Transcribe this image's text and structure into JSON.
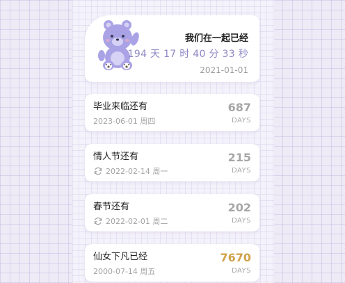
{
  "hero": {
    "title": "我们在一起已经",
    "counter": "194 天 17 时 40 分 33 秒",
    "start_date": "2021-01-01",
    "icon": "bear-mascot-icon"
  },
  "events": [
    {
      "title": "毕业来临还有",
      "date": "2023-06-01 周四",
      "days": "687",
      "unit": "DAYS",
      "repeat": false,
      "color": "#a6a6a6"
    },
    {
      "title": "情人节还有",
      "date": "2022-02-14 周一",
      "days": "215",
      "unit": "DAYS",
      "repeat": true,
      "color": "#a6a6a6"
    },
    {
      "title": "春节还有",
      "date": "2022-02-01 周二",
      "days": "202",
      "unit": "DAYS",
      "repeat": true,
      "color": "#a6a6a6"
    },
    {
      "title": "仙女下凡已经",
      "date": "2000-07-14 周五",
      "days": "7670",
      "unit": "DAYS",
      "repeat": false,
      "color": "#d1a24a"
    }
  ],
  "colors": {
    "accent": "#8f88c6",
    "highlight": "#d1a24a"
  }
}
